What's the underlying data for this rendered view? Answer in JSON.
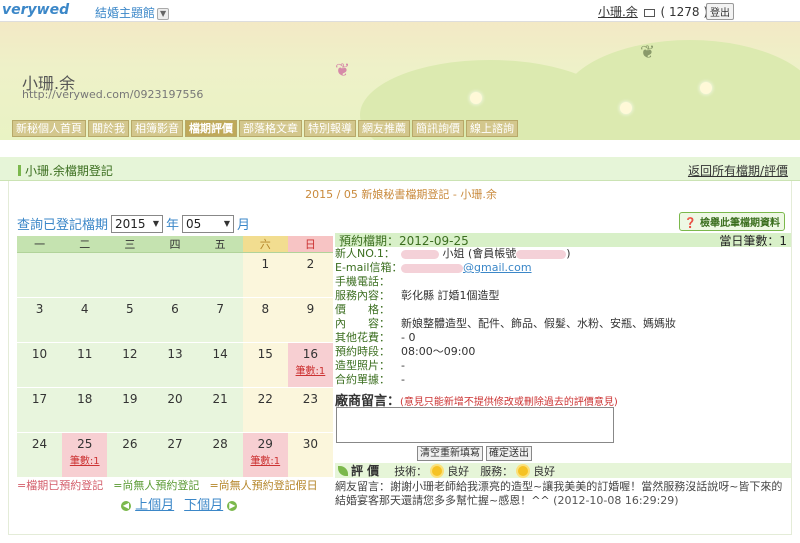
{
  "topbar": {
    "logo": "verywed",
    "site_name": "結婚主題館",
    "user_name": "小珊.余",
    "mail_count": "( 1278 )",
    "logout": "登出"
  },
  "banner": {
    "owner_name": "小珊.余",
    "owner_url": "http://verywed.com/0923197556"
  },
  "nav": [
    {
      "label": "新秘個人首頁"
    },
    {
      "label": "關於我"
    },
    {
      "label": "相簿影音"
    },
    {
      "label": "檔期評價"
    },
    {
      "label": "部落格文章"
    },
    {
      "label": "特別報導"
    },
    {
      "label": "網友推薦"
    },
    {
      "label": "簡訊詢價"
    },
    {
      "label": "線上諮詢"
    }
  ],
  "subhead": {
    "title": "小珊.余檔期登記",
    "back_link": "返回所有檔期/評價"
  },
  "record_title": "2015 / 05 新娘秘書檔期登記 - 小珊.余",
  "query": {
    "label": "查詢已登記檔期",
    "year": "2015",
    "year_unit": "年",
    "month": "05",
    "month_unit": "月"
  },
  "calendar": {
    "headers": [
      "一",
      "二",
      "三",
      "四",
      "五",
      "六",
      "日"
    ],
    "weeks": [
      [
        "",
        "",
        "",
        "",
        "",
        "1",
        "2"
      ],
      [
        "3",
        "4",
        "5",
        "6",
        "7",
        "8",
        "9"
      ],
      [
        "10",
        "11",
        "12",
        "13",
        "14",
        "15",
        "16"
      ],
      [
        "17",
        "18",
        "19",
        "20",
        "21",
        "22",
        "23"
      ],
      [
        "24",
        "25",
        "26",
        "27",
        "28",
        "29",
        "30"
      ]
    ],
    "count_label": "筆數:1"
  },
  "legend": {
    "booked": "=檔期已預約登記",
    "free": "=尚無人預約登記",
    "free_holiday": "=尚無人預約登記假日"
  },
  "month_nav": {
    "prev": "上個月",
    "next": "下個月"
  },
  "detail_button": "檢舉此筆檔期資料",
  "detail": {
    "date": "預約檔期：2012-09-25",
    "count": "當日筆數：1",
    "fields": [
      {
        "label": "新人NO.1：",
        "value": "小姐 (會員帳號"
      },
      {
        "label": "E-mail信箱：",
        "value": "@gmail.com"
      },
      {
        "label": "手機電話：",
        "value": ""
      },
      {
        "label": "服務內容：",
        "value": "彰化縣 訂婚1個造型"
      },
      {
        "label": "價　　格：",
        "value": ""
      },
      {
        "label": "內　　容：",
        "value": "新娘整體造型、配件、飾品、假髮、水粉、安瓶、媽媽妝"
      },
      {
        "label": "其他花費：",
        "value": "- 0"
      },
      {
        "label": "預約時段：",
        "value": "08:00～09:00"
      },
      {
        "label": "造型照片：",
        "value": "-"
      },
      {
        "label": "合約單據：",
        "value": "-"
      }
    ],
    "msg_label": "廠商留言：",
    "msg_note": "(意見只能新增不提供修改或刪除過去的評價意見)",
    "reset_btn": "清空重新填寫",
    "submit_btn": "確定送出",
    "rating_title": "評 價",
    "skill_label": "技術：",
    "skill_value": "良好",
    "service_label": "服務：",
    "service_value": "良好",
    "review_text": "網友留言：謝謝小珊老師給我漂亮的造型~讓我美美的訂婚喔！當然服務沒話說呀~皆下來的結婚宴客那天還請您多多幫忙握~感恩！^^",
    "review_time": "(2012-10-08 16:29:29)"
  },
  "colors": {
    "brand_blue": "#3b87c8",
    "green": "#7bb84c",
    "pink": "#f7cfd2"
  }
}
